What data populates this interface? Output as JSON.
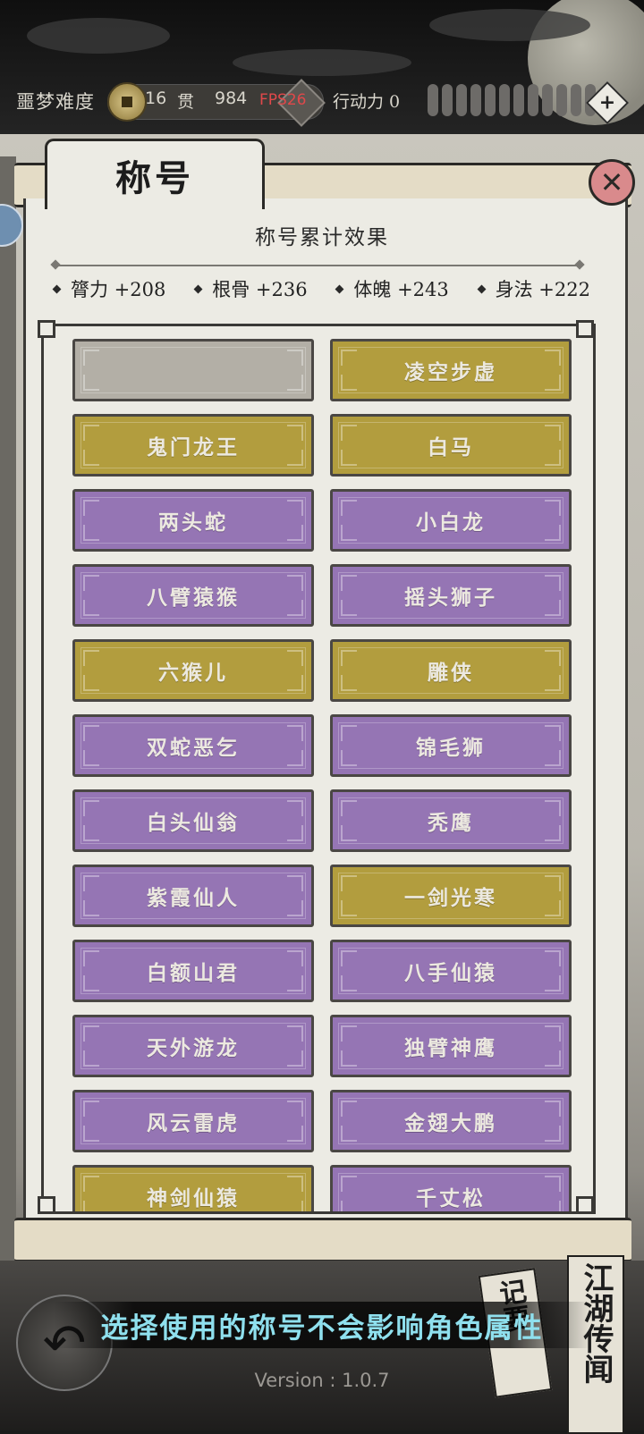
{
  "header": {
    "difficulty": "噩梦难度",
    "coin_count": "16",
    "coin_unit": "贯",
    "coin_value": "984",
    "fps": "FPS26",
    "action_label": "行动力 0",
    "action_bar_count": 12,
    "plus_symbol": "+"
  },
  "panel": {
    "tab_title": "称号",
    "close_symbol": "✕",
    "effect_title": "称号累计效果",
    "stats": [
      {
        "label": "膂力 +208"
      },
      {
        "label": "根骨 +236"
      },
      {
        "label": "体魄 +243"
      },
      {
        "label": "身法 +222"
      }
    ],
    "titles": [
      {
        "name": "",
        "rank": "gray"
      },
      {
        "name": "凌空步虚",
        "rank": "gold"
      },
      {
        "name": "鬼门龙王",
        "rank": "gold"
      },
      {
        "name": "白马",
        "rank": "gold"
      },
      {
        "name": "两头蛇",
        "rank": "purple"
      },
      {
        "name": "小白龙",
        "rank": "purple"
      },
      {
        "name": "八臂猿猴",
        "rank": "purple"
      },
      {
        "name": "摇头狮子",
        "rank": "purple"
      },
      {
        "name": "六猴儿",
        "rank": "gold"
      },
      {
        "name": "雕侠",
        "rank": "gold"
      },
      {
        "name": "双蛇恶乞",
        "rank": "purple"
      },
      {
        "name": "锦毛狮",
        "rank": "purple"
      },
      {
        "name": "白头仙翁",
        "rank": "purple"
      },
      {
        "name": "秃鹰",
        "rank": "purple"
      },
      {
        "name": "紫霞仙人",
        "rank": "purple"
      },
      {
        "name": "一剑光寒",
        "rank": "gold"
      },
      {
        "name": "白额山君",
        "rank": "purple"
      },
      {
        "name": "八手仙猿",
        "rank": "purple"
      },
      {
        "name": "天外游龙",
        "rank": "purple"
      },
      {
        "name": "独臂神鹰",
        "rank": "purple"
      },
      {
        "name": "风云雷虎",
        "rank": "purple"
      },
      {
        "name": "金翅大鹏",
        "rank": "purple"
      },
      {
        "name": "神剑仙猿",
        "rank": "gold"
      },
      {
        "name": "千丈松",
        "rank": "purple"
      }
    ]
  },
  "colors": {
    "gold": "#b29d3e",
    "purple": "#9575b4",
    "gray": "#b3afa6",
    "hint": "#8fe0ee",
    "close": "#d98a8c"
  },
  "footer": {
    "hint": "选择使用的称号不会影响角色属性",
    "side_button_1": "江湖传闻",
    "side_button_2": "记要",
    "back_icon": "back-arrow-icon",
    "back_symbol": "↶",
    "version": "Version : 1.0.7"
  }
}
